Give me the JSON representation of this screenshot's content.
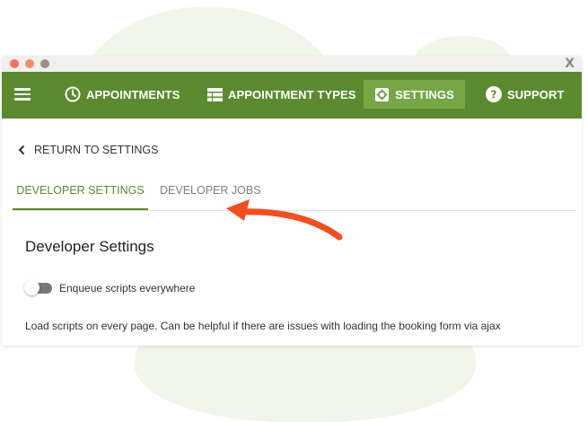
{
  "window": {
    "close_label": "X",
    "dots": [
      "#fe6f5e",
      "#f28c6b",
      "#9b8e86"
    ]
  },
  "colors": {
    "brand_green": "#5b8a2f",
    "active_nav": "#76a646",
    "arrow": "#f14f1f"
  },
  "nav": {
    "menu_icon": "hamburger-icon",
    "items": [
      {
        "label": "APPOINTMENTS",
        "icon": "clock-icon"
      },
      {
        "label": "APPOINTMENT TYPES",
        "icon": "table-icon"
      },
      {
        "label": "SETTINGS",
        "icon": "gear-icon",
        "active": true
      },
      {
        "label": "SUPPORT",
        "icon": "question-icon"
      }
    ]
  },
  "back_link": {
    "label": "RETURN TO SETTINGS",
    "icon": "chevron-left-icon"
  },
  "tabs": [
    {
      "label": "DEVELOPER SETTINGS",
      "active": true
    },
    {
      "label": "DEVELOPER JOBS",
      "active": false
    }
  ],
  "content": {
    "section_title": "Developer Settings",
    "toggle_label": "Enqueue scripts everywhere",
    "toggle_on": false,
    "help_text": "Load scripts on every page. Can be helpful if there are issues with loading the booking form via ajax"
  }
}
